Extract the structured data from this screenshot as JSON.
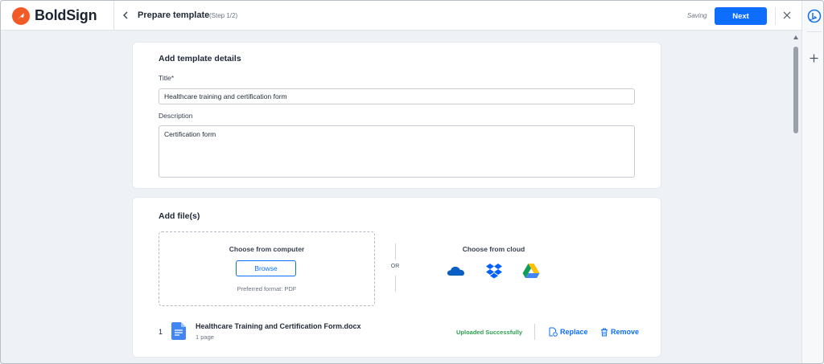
{
  "app": {
    "name": "BoldSign",
    "brand_color": "#f25b25",
    "accent_color": "#0d6efd"
  },
  "header": {
    "title": "Prepare template",
    "step": "(Step 1/2)",
    "status": "Saving",
    "next_label": "Next"
  },
  "template_details": {
    "heading": "Add template details",
    "title_label": "Title*",
    "title_value": "Healthcare training and certification form",
    "description_label": "Description",
    "description_value": "Certification form"
  },
  "files": {
    "heading": "Add file(s)",
    "computer_title": "Choose from computer",
    "browse_label": "Browse",
    "preferred_format": "Preferred format: PDF",
    "or_text": "OR",
    "cloud_title": "Choose from cloud",
    "cloud_providers": [
      "onedrive-icon",
      "dropbox-icon",
      "google-drive-icon"
    ],
    "items": [
      {
        "index": "1",
        "name": "Healthcare Training and Certification Form.docx",
        "pages": "1 page",
        "status": "Uploaded Successfully",
        "status_color": "#2e9e4f",
        "replace_label": "Replace",
        "remove_label": "Remove"
      }
    ]
  }
}
